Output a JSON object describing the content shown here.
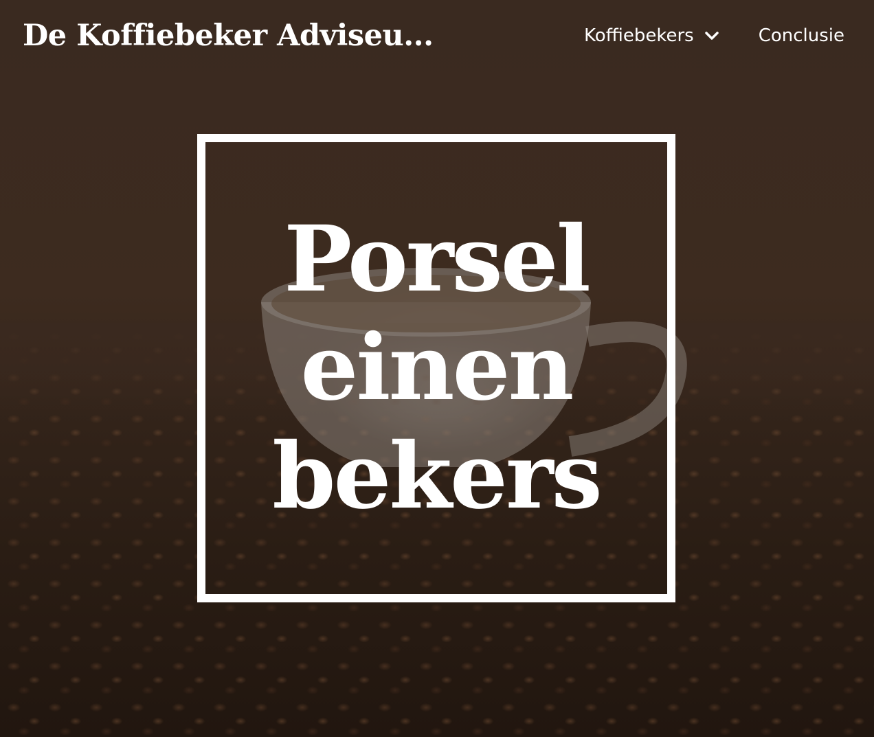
{
  "header": {
    "site_title": "De Koffiebeker Adviseu..."
  },
  "nav": {
    "items": [
      {
        "label": "Koffiebekers",
        "icon": "chevron-down-icon"
      },
      {
        "label": "Conclusie"
      }
    ]
  },
  "hero": {
    "title": "Porsel einen bekers",
    "image": "coffee-cup-on-beans"
  },
  "colors": {
    "text": "#ffffff",
    "overlay": "#2a1c13"
  }
}
